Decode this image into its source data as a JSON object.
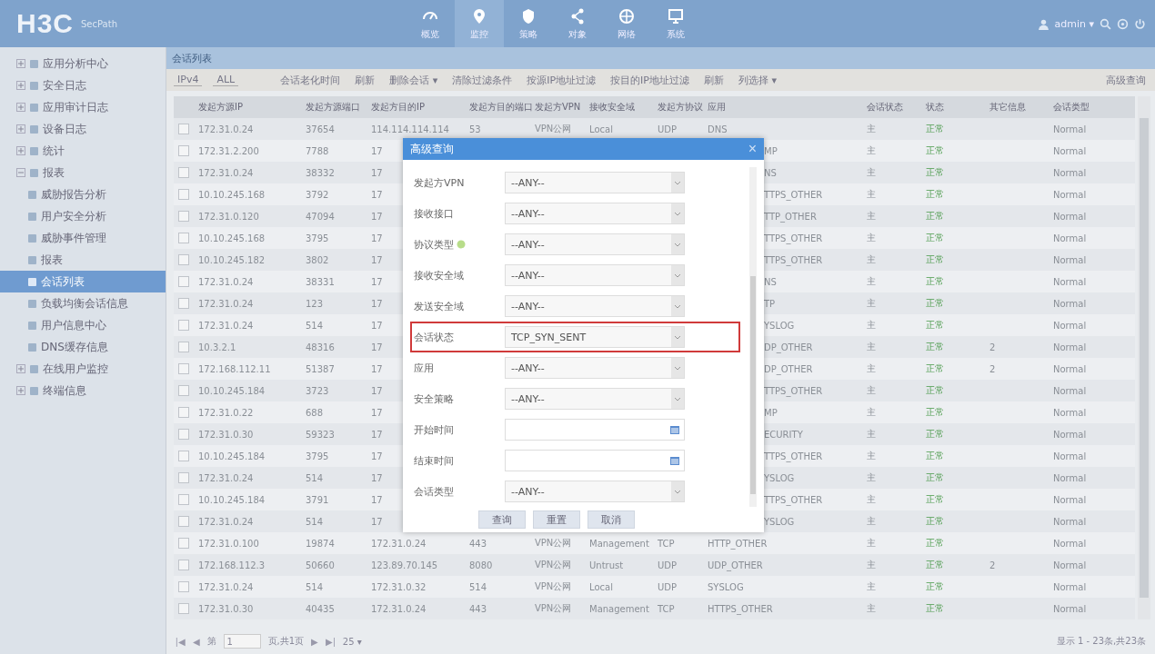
{
  "header": {
    "logo": "H3C",
    "product": "SecPath",
    "nav": [
      {
        "label": "概览",
        "selected": false
      },
      {
        "label": "监控",
        "selected": true
      },
      {
        "label": "策略",
        "selected": false
      },
      {
        "label": "对象",
        "selected": false
      },
      {
        "label": "网络",
        "selected": false
      },
      {
        "label": "系统",
        "selected": false
      }
    ],
    "user": "admin ▾"
  },
  "sidebar": {
    "items": [
      {
        "label": "应用分析中心",
        "expanded": false,
        "selected": false
      },
      {
        "label": "安全日志",
        "expanded": false,
        "selected": false
      },
      {
        "label": "应用审计日志",
        "expanded": false,
        "selected": false
      },
      {
        "label": "设备日志",
        "expanded": false,
        "selected": false
      },
      {
        "label": "统计",
        "expanded": false,
        "selected": false
      },
      {
        "label": "报表",
        "expanded": true,
        "selected": false,
        "children": [
          {
            "label": "威胁报告分析",
            "selected": false
          },
          {
            "label": "用户安全分析",
            "selected": false
          },
          {
            "label": "威胁事件管理",
            "selected": false
          },
          {
            "label": "报表",
            "selected": false
          },
          {
            "label": "会话列表",
            "selected": true
          },
          {
            "label": "负载均衡会话信息",
            "selected": false
          },
          {
            "label": "用户信息中心",
            "selected": false
          },
          {
            "label": "DNS缓存信息",
            "selected": false
          }
        ]
      },
      {
        "label": "在线用户监控",
        "expanded": false,
        "selected": false
      },
      {
        "label": "终端信息",
        "expanded": false,
        "selected": false
      }
    ]
  },
  "breadcrumb": "会话列表",
  "toolbar": {
    "ip_version": "IPv4",
    "scope": "ALL",
    "actions": [
      "会话老化时间",
      "刷新",
      "删除会话 ▾",
      "清除过滤条件",
      "按源IP地址过滤",
      "按目的IP地址过滤",
      "刷新",
      "列选择 ▾"
    ],
    "advanced": "高级查询"
  },
  "table": {
    "columns": [
      "发起方源IP",
      "发起方源端口",
      "发起方目的IP",
      "发起方目的端口",
      "发起方VPN",
      "接收安全域",
      "发起方协议",
      "应用",
      "会话状态",
      "状态",
      "其它信息",
      "会话类型"
    ],
    "rows": [
      {
        "checked": false,
        "cells": [
          "172.31.0.24",
          "37654",
          "114.114.114.114",
          "53",
          "VPN公网",
          "Local",
          "UDP",
          "DNS",
          "主",
          "正常",
          null,
          "Normal"
        ]
      },
      {
        "checked": false,
        "cells": [
          "172.31.2.200",
          "7788",
          "17",
          null,
          null,
          null,
          null,
          "MP",
          "主",
          "正常",
          null,
          "Normal"
        ]
      },
      {
        "checked": false,
        "cells": [
          "172.31.0.24",
          "38332",
          "17",
          null,
          null,
          null,
          null,
          "NS",
          "主",
          "正常",
          null,
          "Normal"
        ]
      },
      {
        "checked": false,
        "cells": [
          "10.10.245.168",
          "3792",
          "17",
          null,
          null,
          null,
          null,
          "TTPS_OTHER",
          "主",
          "正常",
          null,
          "Normal"
        ]
      },
      {
        "checked": false,
        "cells": [
          "172.31.0.120",
          "47094",
          "17",
          null,
          null,
          null,
          null,
          "TTP_OTHER",
          "主",
          "正常",
          null,
          "Normal"
        ]
      },
      {
        "checked": false,
        "cells": [
          "10.10.245.168",
          "3795",
          "17",
          null,
          null,
          null,
          null,
          "TTPS_OTHER",
          "主",
          "正常",
          null,
          "Normal"
        ]
      },
      {
        "checked": false,
        "cells": [
          "10.10.245.182",
          "3802",
          "17",
          null,
          null,
          null,
          null,
          "TTPS_OTHER",
          "主",
          "正常",
          null,
          "Normal"
        ]
      },
      {
        "checked": false,
        "cells": [
          "172.31.0.24",
          "38331",
          "17",
          null,
          null,
          null,
          null,
          "NS",
          "主",
          "正常",
          null,
          "Normal"
        ]
      },
      {
        "checked": false,
        "cells": [
          "172.31.0.24",
          "123",
          "17",
          null,
          null,
          null,
          null,
          "TP",
          "主",
          "正常",
          null,
          "Normal"
        ]
      },
      {
        "checked": false,
        "cells": [
          "172.31.0.24",
          "514",
          "17",
          null,
          null,
          null,
          null,
          "YSLOG",
          "主",
          "正常",
          null,
          "Normal"
        ]
      },
      {
        "checked": false,
        "cells": [
          "10.3.2.1",
          "48316",
          "17",
          null,
          null,
          null,
          null,
          "DP_OTHER",
          "主",
          "正常",
          "2",
          "Normal"
        ]
      },
      {
        "checked": false,
        "cells": [
          "172.168.112.11",
          "51387",
          "17",
          null,
          null,
          null,
          null,
          "DP_OTHER",
          "主",
          "正常",
          "2",
          "Normal"
        ]
      },
      {
        "checked": false,
        "cells": [
          "10.10.245.184",
          "3723",
          "17",
          null,
          null,
          null,
          null,
          "TTPS_OTHER",
          "主",
          "正常",
          null,
          "Normal"
        ]
      },
      {
        "checked": false,
        "cells": [
          "172.31.0.22",
          "688",
          "17",
          null,
          null,
          null,
          null,
          "MP",
          "主",
          "正常",
          null,
          "Normal"
        ]
      },
      {
        "checked": false,
        "cells": [
          "172.31.0.30",
          "59323",
          "17",
          null,
          null,
          null,
          null,
          "ECURITY",
          "主",
          "正常",
          null,
          "Normal"
        ]
      },
      {
        "checked": false,
        "cells": [
          "10.10.245.184",
          "3795",
          "17",
          null,
          null,
          null,
          null,
          "TTPS_OTHER",
          "主",
          "正常",
          null,
          "Normal"
        ]
      },
      {
        "checked": false,
        "cells": [
          "172.31.0.24",
          "514",
          "17",
          null,
          null,
          null,
          null,
          "YSLOG",
          "主",
          "正常",
          null,
          "Normal"
        ]
      },
      {
        "checked": false,
        "cells": [
          "10.10.245.184",
          "3791",
          "17",
          null,
          null,
          null,
          null,
          "TTPS_OTHER",
          "主",
          "正常",
          null,
          "Normal"
        ]
      },
      {
        "checked": false,
        "cells": [
          "172.31.0.24",
          "514",
          "17",
          null,
          null,
          null,
          null,
          "YSLOG",
          "主",
          "正常",
          null,
          "Normal"
        ]
      },
      {
        "checked": false,
        "cells": [
          "172.31.0.100",
          "19874",
          "172.31.0.24",
          "443",
          "VPN公网",
          "Management",
          "TCP",
          "HTTP_OTHER",
          "主",
          "正常",
          null,
          "Normal"
        ]
      },
      {
        "checked": false,
        "cells": [
          "172.168.112.3",
          "50660",
          "123.89.70.145",
          "8080",
          "VPN公网",
          "Untrust",
          "UDP",
          "UDP_OTHER",
          "主",
          "正常",
          "2",
          "Normal"
        ]
      },
      {
        "checked": false,
        "cells": [
          "172.31.0.24",
          "514",
          "172.31.0.32",
          "514",
          "VPN公网",
          "Local",
          "UDP",
          "SYSLOG",
          "主",
          "正常",
          null,
          "Normal"
        ]
      },
      {
        "checked": false,
        "cells": [
          "172.31.0.30",
          "40435",
          "172.31.0.24",
          "443",
          "VPN公网",
          "Management",
          "TCP",
          "HTTPS_OTHER",
          "主",
          "正常",
          null,
          "Normal"
        ]
      }
    ]
  },
  "pager": {
    "first": "|◀",
    "prev": "◀",
    "next": "▶",
    "last": "▶|",
    "page_label": "第",
    "page": "1",
    "total_pages": "页,共1页",
    "page_size": "25 ▾",
    "summary": "显示 1 - 23条,共23条"
  },
  "dialog": {
    "title": "高级查询",
    "close": "×",
    "fields": [
      {
        "label": "发起方VPN",
        "kind": "select",
        "value": "--ANY--",
        "highlighted": false,
        "help": false
      },
      {
        "label": "接收接口",
        "kind": "select",
        "value": "--ANY--",
        "highlighted": false,
        "help": false
      },
      {
        "label": "协议类型",
        "kind": "select",
        "value": "--ANY--",
        "highlighted": false,
        "help": true
      },
      {
        "label": "接收安全域",
        "kind": "select",
        "value": "--ANY--",
        "highlighted": false,
        "help": false
      },
      {
        "label": "发送安全域",
        "kind": "select",
        "value": "--ANY--",
        "highlighted": false,
        "help": false
      },
      {
        "label": "会话状态",
        "kind": "select",
        "value": "TCP_SYN_SENT",
        "highlighted": true,
        "help": false
      },
      {
        "label": "应用",
        "kind": "select",
        "value": "--ANY--",
        "highlighted": false,
        "help": false
      },
      {
        "label": "安全策略",
        "kind": "select",
        "value": "--ANY--",
        "highlighted": false,
        "help": false
      },
      {
        "label": "开始时间",
        "kind": "date",
        "highlighted": false,
        "help": false
      },
      {
        "label": "结束时间",
        "kind": "date",
        "highlighted": false,
        "help": false
      },
      {
        "label": "会话类型",
        "kind": "select",
        "value": "--ANY--",
        "highlighted": false,
        "help": false
      }
    ],
    "buttons": [
      "查询",
      "重置",
      "取消"
    ]
  }
}
